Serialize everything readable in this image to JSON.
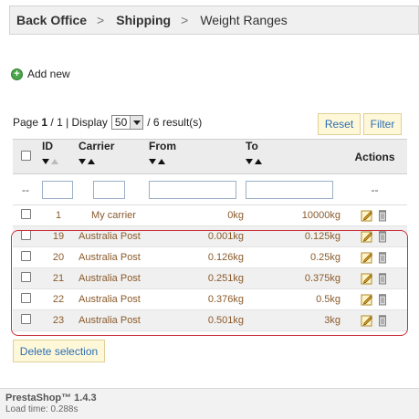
{
  "breadcrumb": {
    "items": [
      "Back Office",
      "Shipping",
      "Weight Ranges"
    ],
    "separator": ">"
  },
  "add_new": {
    "label": "Add new",
    "icon": "add-icon"
  },
  "pagination": {
    "page_label": "Page",
    "current_page": "1",
    "page_sep": " / ",
    "total_pages": "1",
    "display_label": "| Display",
    "per_page": "50",
    "results": "/ 6 result(s)"
  },
  "buttons": {
    "reset": "Reset",
    "filter": "Filter",
    "delete_selection": "Delete selection"
  },
  "table": {
    "columns": [
      "ID",
      "Carrier",
      "From",
      "To",
      "Actions"
    ],
    "filter_placeholder_dash": "--",
    "rows": [
      {
        "id": "1",
        "carrier": "My carrier",
        "from": "0kg",
        "to": "10000kg"
      },
      {
        "id": "19",
        "carrier": "Australia Post",
        "from": "0.001kg",
        "to": "0.125kg"
      },
      {
        "id": "20",
        "carrier": "Australia Post",
        "from": "0.126kg",
        "to": "0.25kg"
      },
      {
        "id": "21",
        "carrier": "Australia Post",
        "from": "0.251kg",
        "to": "0.375kg"
      },
      {
        "id": "22",
        "carrier": "Australia Post",
        "from": "0.376kg",
        "to": "0.5kg"
      },
      {
        "id": "23",
        "carrier": "Australia Post",
        "from": "0.501kg",
        "to": "3kg"
      }
    ]
  },
  "footer": {
    "version": "PrestaShop™ 1.4.3",
    "load_time": "Load time: 0.288s"
  },
  "colors": {
    "accent_link": "#2a6db5",
    "value_text": "#8a5a2a",
    "highlight_border": "#c8323c",
    "button_bg": "#fff8d8"
  }
}
